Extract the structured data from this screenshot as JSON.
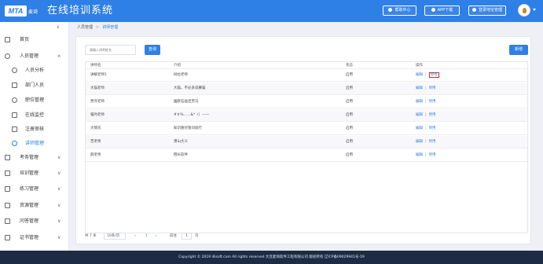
{
  "header": {
    "logo_text": "MTA",
    "logo_sub": "麦琦",
    "title": "在线培训系统",
    "help_label": "帮助中心",
    "app_label": "APP下载",
    "login_label": "登录地址管理"
  },
  "sidebar": {
    "collapse_glyph": "‹",
    "items": [
      {
        "label": "首页"
      },
      {
        "label": "人员管理",
        "arrow": "∧"
      },
      {
        "label": "人员分析"
      },
      {
        "label": "部门人员"
      },
      {
        "label": "职位管理"
      },
      {
        "label": "在线监控"
      },
      {
        "label": "注册审核"
      },
      {
        "label": "讲师管理"
      },
      {
        "label": "考务管理",
        "arrow": "∨"
      },
      {
        "label": "培训管理",
        "arrow": "∨"
      },
      {
        "label": "练习管理",
        "arrow": "∨"
      },
      {
        "label": "资源管理",
        "arrow": "∨"
      },
      {
        "label": "问答管理",
        "arrow": "∨"
      },
      {
        "label": "证书管理",
        "arrow": "∨"
      }
    ]
  },
  "breadcrumb": {
    "parent": "人员管理",
    "sep": ">",
    "current": "讲师管理"
  },
  "search": {
    "placeholder": "请输入讲师姓名",
    "query_label": "查询",
    "add_label": "新增"
  },
  "table": {
    "headers": [
      "讲师名",
      "介绍",
      "状态",
      "操作"
    ],
    "rows": [
      {
        "name": "讲解老师1",
        "intro": "树拉老师",
        "status": "启用",
        "edit": "编辑",
        "disable": "停用"
      },
      {
        "name": "大猫老师",
        "intro": "大猫，不必多说赛猫",
        "status": "启用",
        "edit": "编辑",
        "disable": "停用"
      },
      {
        "name": "贾许老师",
        "intro": "幽默石画连劳马",
        "status": "启用",
        "edit": "编辑",
        "disable": "停用"
      },
      {
        "name": "临时老师",
        "intro": "#￥%……&*（）——",
        "status": "启用",
        "edit": "编辑",
        "disable": "停用"
      },
      {
        "name": "大情兄",
        "intro": "知识随尽管问就行",
        "status": "启用",
        "edit": "编辑",
        "disable": "停用"
      },
      {
        "name": "苦老师",
        "intro": "萧山大义",
        "status": "启用",
        "edit": "编辑",
        "disable": "停用"
      },
      {
        "name": "薛老师",
        "intro": "擅长软件",
        "status": "启用",
        "edit": "编辑",
        "disable": "停用"
      }
    ],
    "op_sep": "|"
  },
  "pagination": {
    "total": "共 7 条",
    "page_size": "10条/页",
    "prev": "‹",
    "current_page": "1",
    "next": "›",
    "goto_label": "前往",
    "goto_value": "1",
    "unit": "页"
  },
  "footer": {
    "text": "Copyright © 2019 illisoft.com All rights reserved 大连麦琦软件工程有限公司 版权所有 辽ICP备09029941号-19"
  }
}
